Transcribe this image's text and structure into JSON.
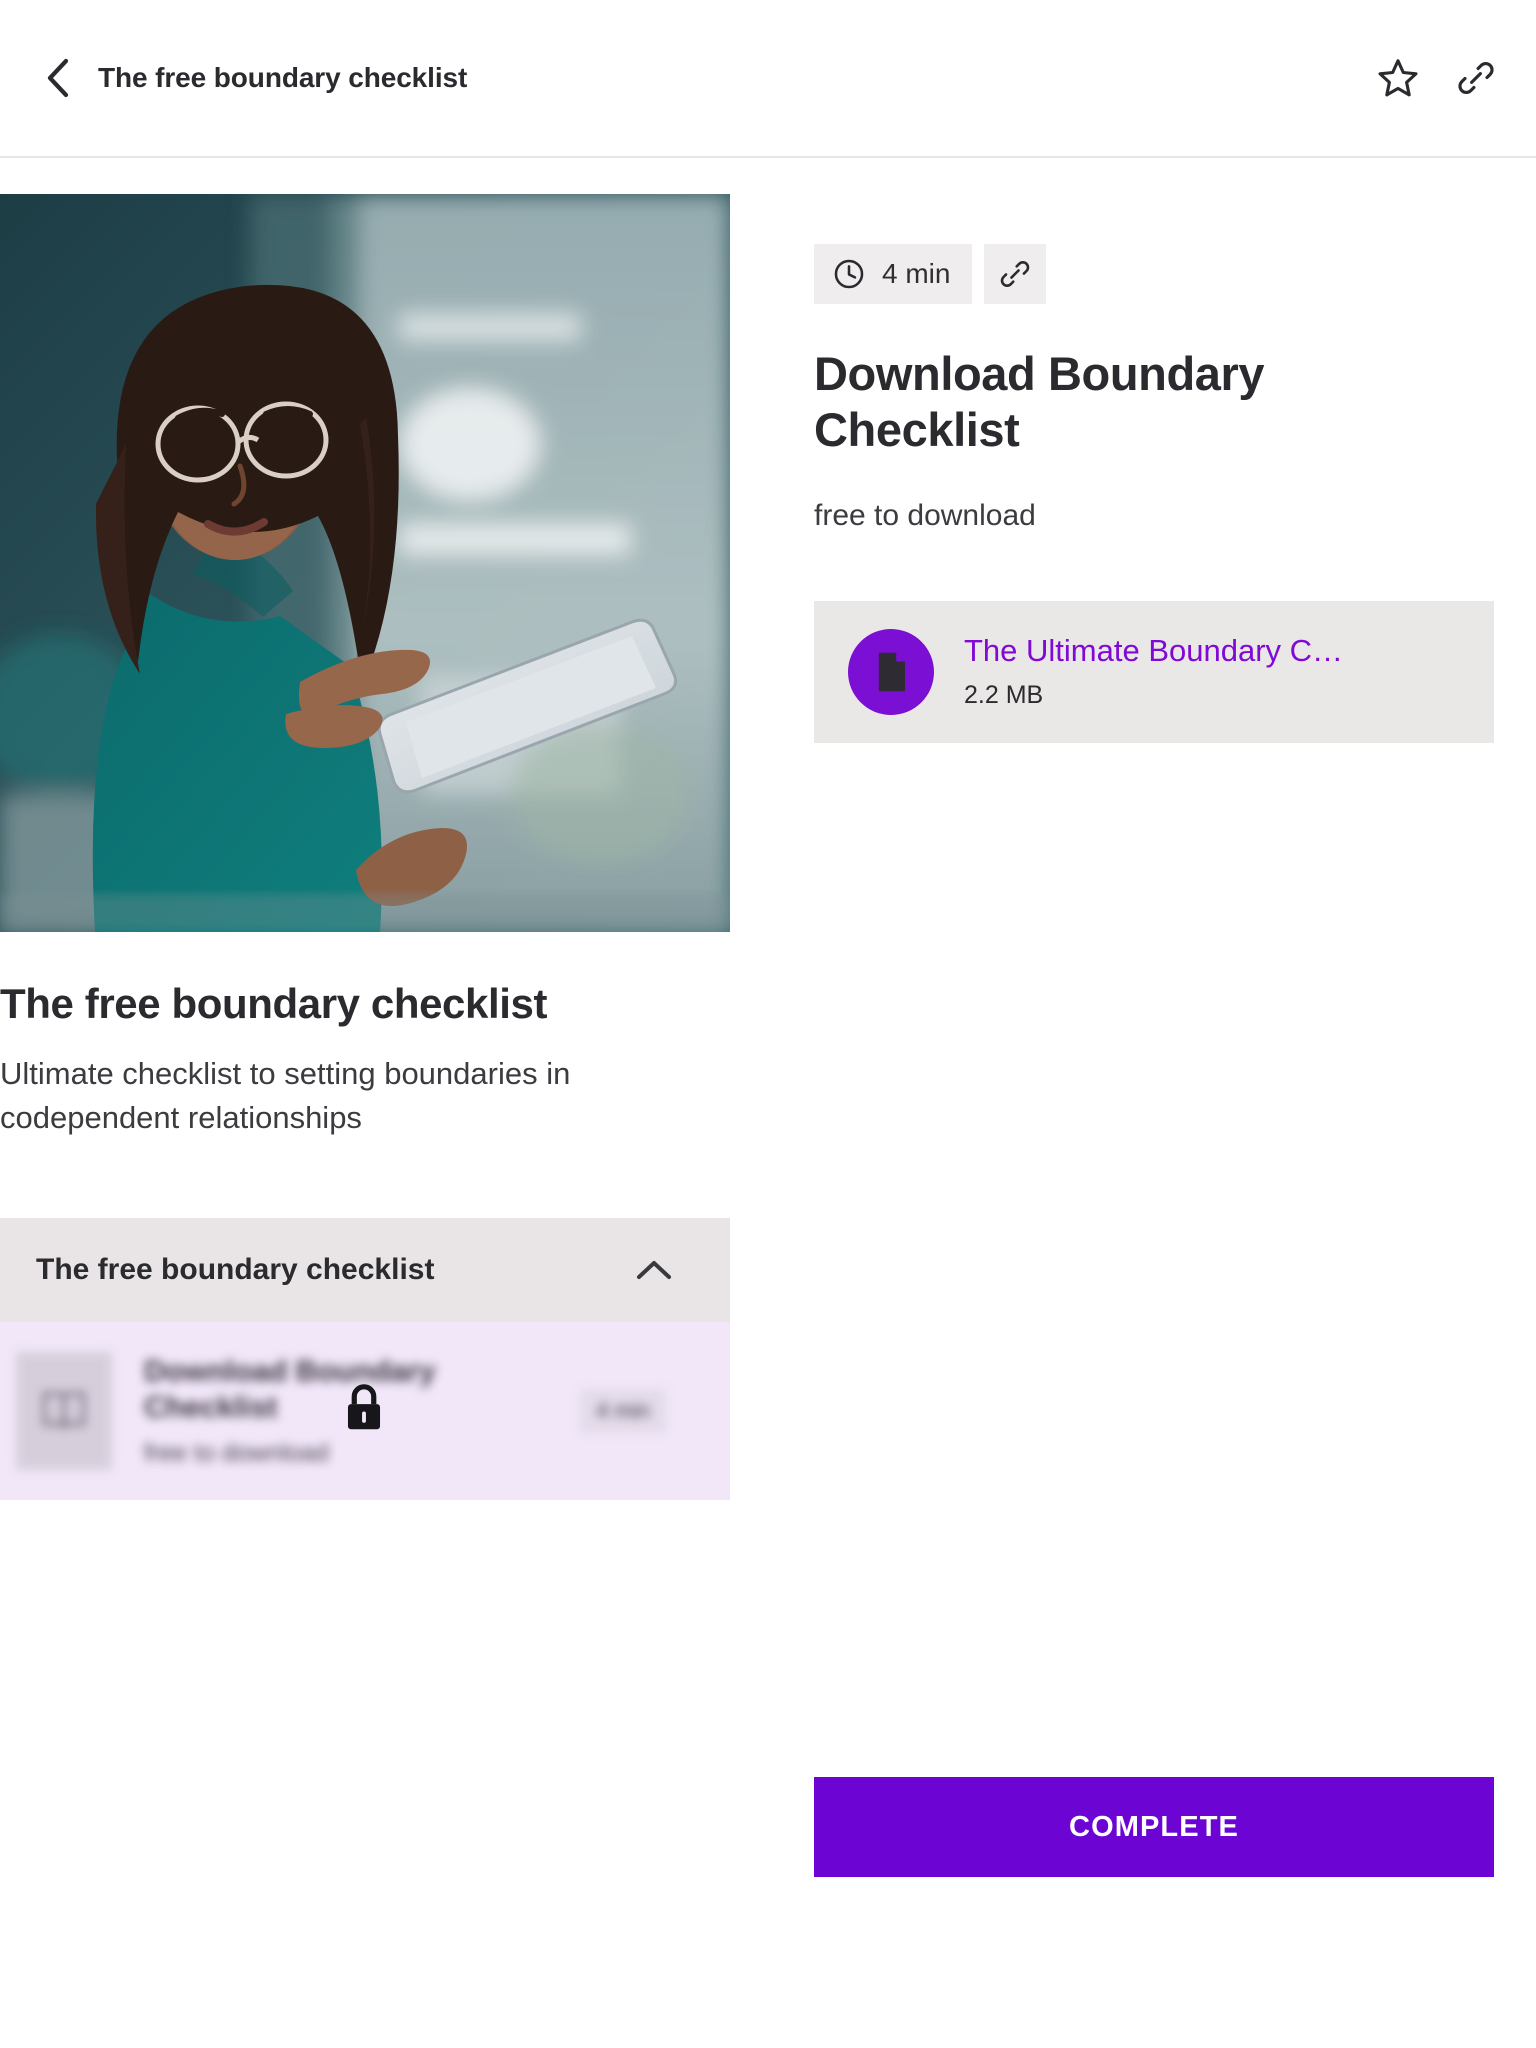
{
  "topbar": {
    "back_icon": "chevron-left-icon",
    "title": "The free boundary checklist",
    "favorite_icon": "star-outline-icon",
    "share_icon": "link-icon"
  },
  "left": {
    "hero_image_alt": "woman-with-tablet-photo",
    "lesson_title": "The free boundary checklist",
    "lesson_description": "Ultimate checklist to setting boundaries in codependent relationships",
    "accordion": {
      "title": "The free boundary checklist",
      "toggle_icon": "chevron-up-icon",
      "expanded": true,
      "items": [
        {
          "thumb_icon": "book-icon",
          "name": "Download Boundary Checklist",
          "subtitle": "free to download",
          "duration": "4 min",
          "locked": true,
          "lock_icon": "lock-icon"
        }
      ]
    }
  },
  "right": {
    "duration_icon": "clock-icon",
    "duration": "4 min",
    "share_icon": "link-icon",
    "title": "Download Boundary Checklist",
    "subtitle": "free to download",
    "attachment": {
      "file_icon": "document-icon",
      "name": "The Ultimate Boundary C…",
      "size": "2.2 MB"
    },
    "complete_label": "COMPLETE"
  },
  "colors": {
    "brand_purple": "#6c05d4",
    "file_link_purple": "#8009d6",
    "file_avatar_purple": "#7b0fd4",
    "chip_gray": "#efeded",
    "accordion_gray": "#e9e5e7",
    "lesson_row_lavender": "#f1e7f9"
  }
}
